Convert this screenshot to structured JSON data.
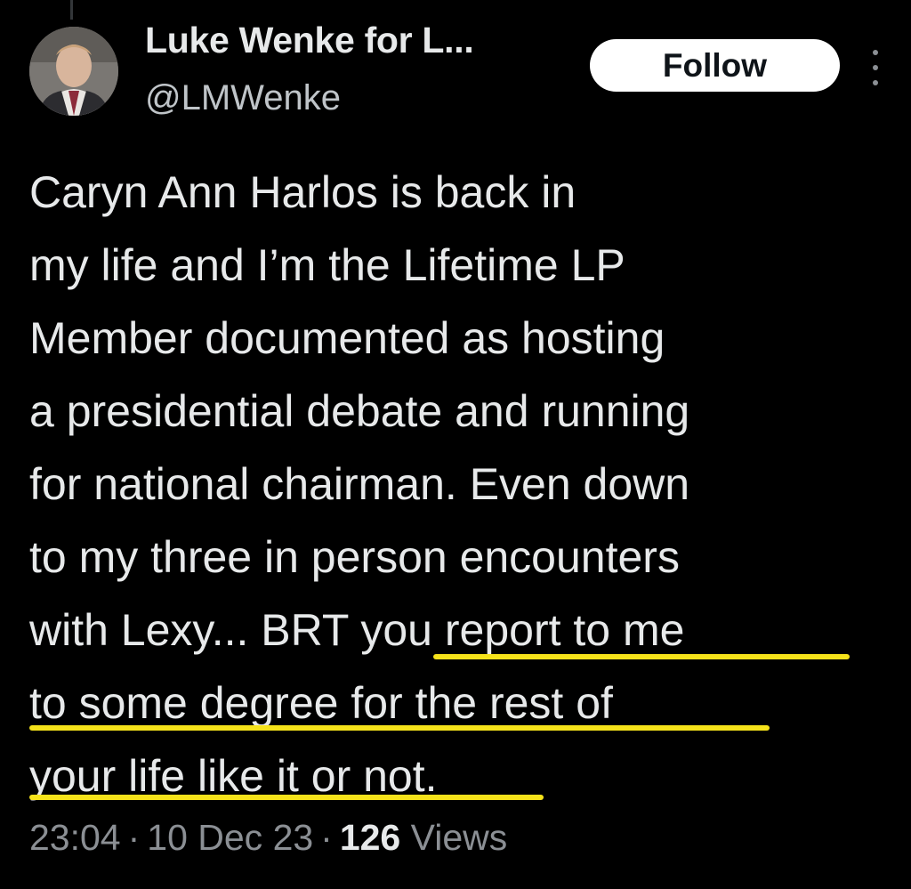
{
  "author": {
    "display_name": "Luke Wenke for L...",
    "handle": "@LMWenke"
  },
  "follow_button": {
    "label": "Follow"
  },
  "more_icon": "vertical-ellipsis-icon",
  "tweet": {
    "lines": [
      "Caryn Ann Harlos is back in",
      "my life and I’m the Lifetime LP",
      "Member documented as hosting",
      "a presidential debate and running",
      "for national chairman.  Even down",
      "to my three in person encounters"
    ],
    "line7_plain": "with Lexy... BRT ",
    "line7_highlight": "you report to me",
    "line8_highlight": "to some degree for the rest of",
    "line9_highlight": "your life like it or not."
  },
  "meta": {
    "time": "23:04",
    "date": "10 Dec 23",
    "views_count": "126",
    "views_label": "Views"
  },
  "colors": {
    "background": "#000000",
    "text": "#e7e9ea",
    "secondary_text": "#8b8f94",
    "follow_button_bg": "#ffffff",
    "highlight_underline": "#f5e21a"
  }
}
